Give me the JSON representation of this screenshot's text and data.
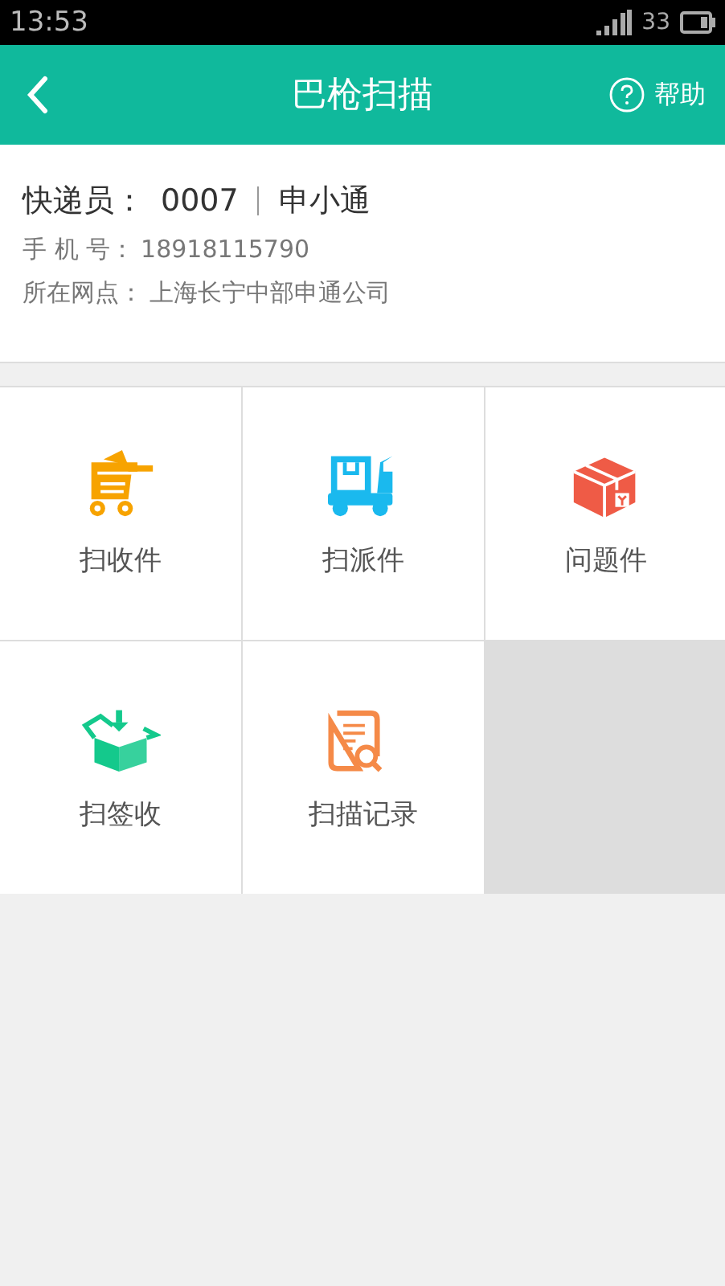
{
  "status_bar": {
    "time": "13:53",
    "battery": "33"
  },
  "header": {
    "title": "巴枪扫描",
    "help": "帮助"
  },
  "courier": {
    "label": "快递员：",
    "id": "0007",
    "name": "申小通",
    "phone_label": "手 机 号：",
    "phone": "18918115790",
    "branch_label": "所在网点：",
    "branch": "上海长宁中部申通公司"
  },
  "tiles": [
    {
      "kind": "cart",
      "label": "扫收件",
      "color": "#f7a300"
    },
    {
      "kind": "truck",
      "label": "扫派件",
      "color": "#1ab9ee"
    },
    {
      "kind": "box",
      "label": "问题件",
      "color": "#ef5b46"
    },
    {
      "kind": "openbox",
      "label": "扫签收",
      "color": "#14c98c"
    },
    {
      "kind": "document",
      "label": "扫描记录",
      "color": "#f58a48"
    }
  ]
}
